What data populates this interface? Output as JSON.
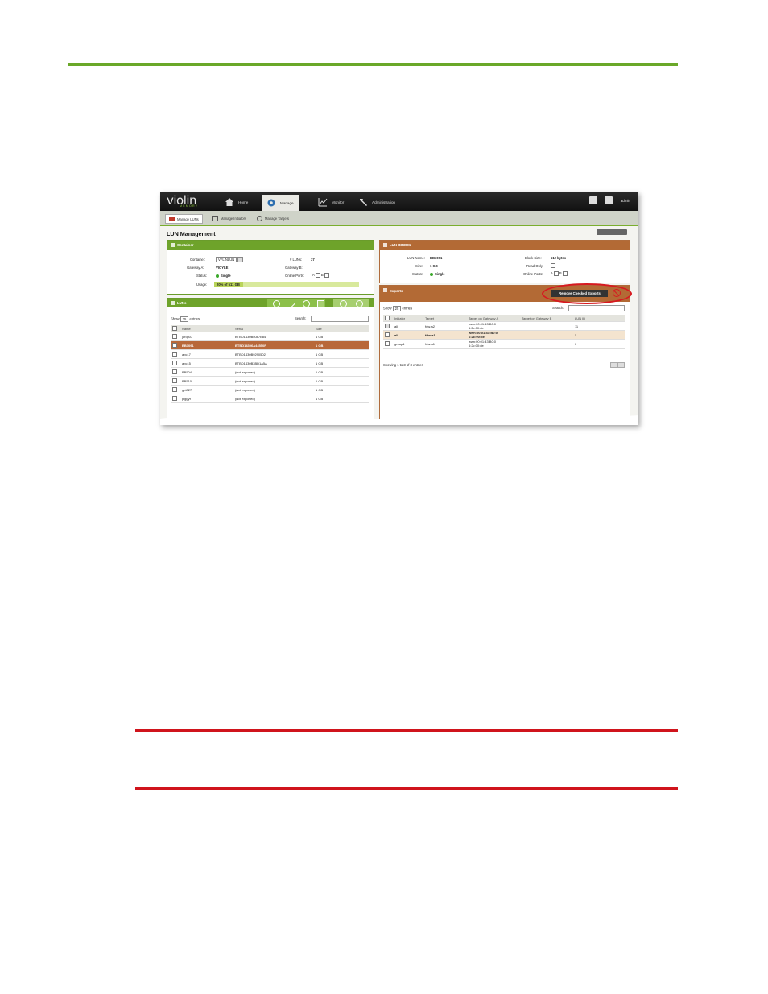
{
  "app": {
    "logo": "violin",
    "logo_sub": "MEMORY",
    "user": "admin"
  },
  "nav": [
    "Home",
    "Manage",
    "Monitor",
    "Administration"
  ],
  "subnav": [
    "Manage LUNs",
    "Manage Initiators",
    "Manage Targets"
  ],
  "page_title": "LUN Management",
  "container_panel": {
    "title": "Container",
    "container_label": "Container:",
    "container_value": "VFLINLUN",
    "luns_label": "# LUNs:",
    "luns_value": "37",
    "gateway_a_label": "Gateway A:",
    "gateway_a_value": "VIOYLE",
    "gateway_b_label": "Gateway B:",
    "status_label": "Status:",
    "status_value": "Single",
    "online_ports_label": "Online Ports:",
    "port_a": "A",
    "port_b": "B",
    "usage_label": "Usage:",
    "usage_value": "20% of 511 GB"
  },
  "luns_panel": {
    "title": "LUNs",
    "show": "Show",
    "show_value": "25",
    "entries": "entries",
    "search": "Search:",
    "headers": [
      "Name",
      "Serial",
      "Size"
    ],
    "rows": [
      [
        "jurojt07",
        "BTBD1430B5087E84",
        "1 GB"
      ],
      [
        "BB3091",
        "BTBD14306A44550F",
        "1 GB"
      ],
      [
        "abc17",
        "BTBD1430B9290502",
        "1 GB"
      ],
      [
        "abc15",
        "BTBD1430B3BD1A5A",
        "1 GB"
      ],
      [
        "BB504",
        "(not exported)",
        "1 GB"
      ],
      [
        "BB510",
        "(not exported)",
        "1 GB"
      ],
      [
        "gbt027",
        "(not exported)",
        "1 GB"
      ],
      [
        "piggyf",
        "(not exported)",
        "1 GB"
      ]
    ]
  },
  "lun_panel": {
    "title": "LUN BB3091",
    "lun_name_label": "LUN Name:",
    "lun_name_value": "BB3091",
    "size_label": "Size:",
    "size_value": "1 GB",
    "status_label": "Status:",
    "status_value": "Single",
    "block_size_label": "Block Size:",
    "block_size_value": "512 bytes",
    "read_only_label": "Read-Only:",
    "online_ports_label": "Online Ports:",
    "port_a": "A",
    "port_b": "B"
  },
  "exports_panel": {
    "title": "Exports",
    "remove_button": "Remove Checked Exports",
    "show": "Show",
    "show_value": "25",
    "entries": "entries",
    "search": "Search:",
    "headers": [
      "Initiator",
      "Target",
      "Target on Gateway A",
      "Target on Gateway B",
      "LUN ID"
    ],
    "rows": [
      [
        "all",
        "fdw-a2",
        "wwn:00:01:43:B0:0",
        "6:2c:00:de",
        "",
        "11"
      ],
      [
        "all",
        "fdw-a1",
        "wwn:00:01:43:B0:0",
        "6:2c:00:de",
        "",
        "3"
      ],
      [
        "group1",
        "fdw-a1",
        "wwn:00:01:43:B0:0",
        "6:2c:00:de",
        "",
        "0"
      ]
    ],
    "footer": "Showing 1 to 3 of 3 entries"
  }
}
